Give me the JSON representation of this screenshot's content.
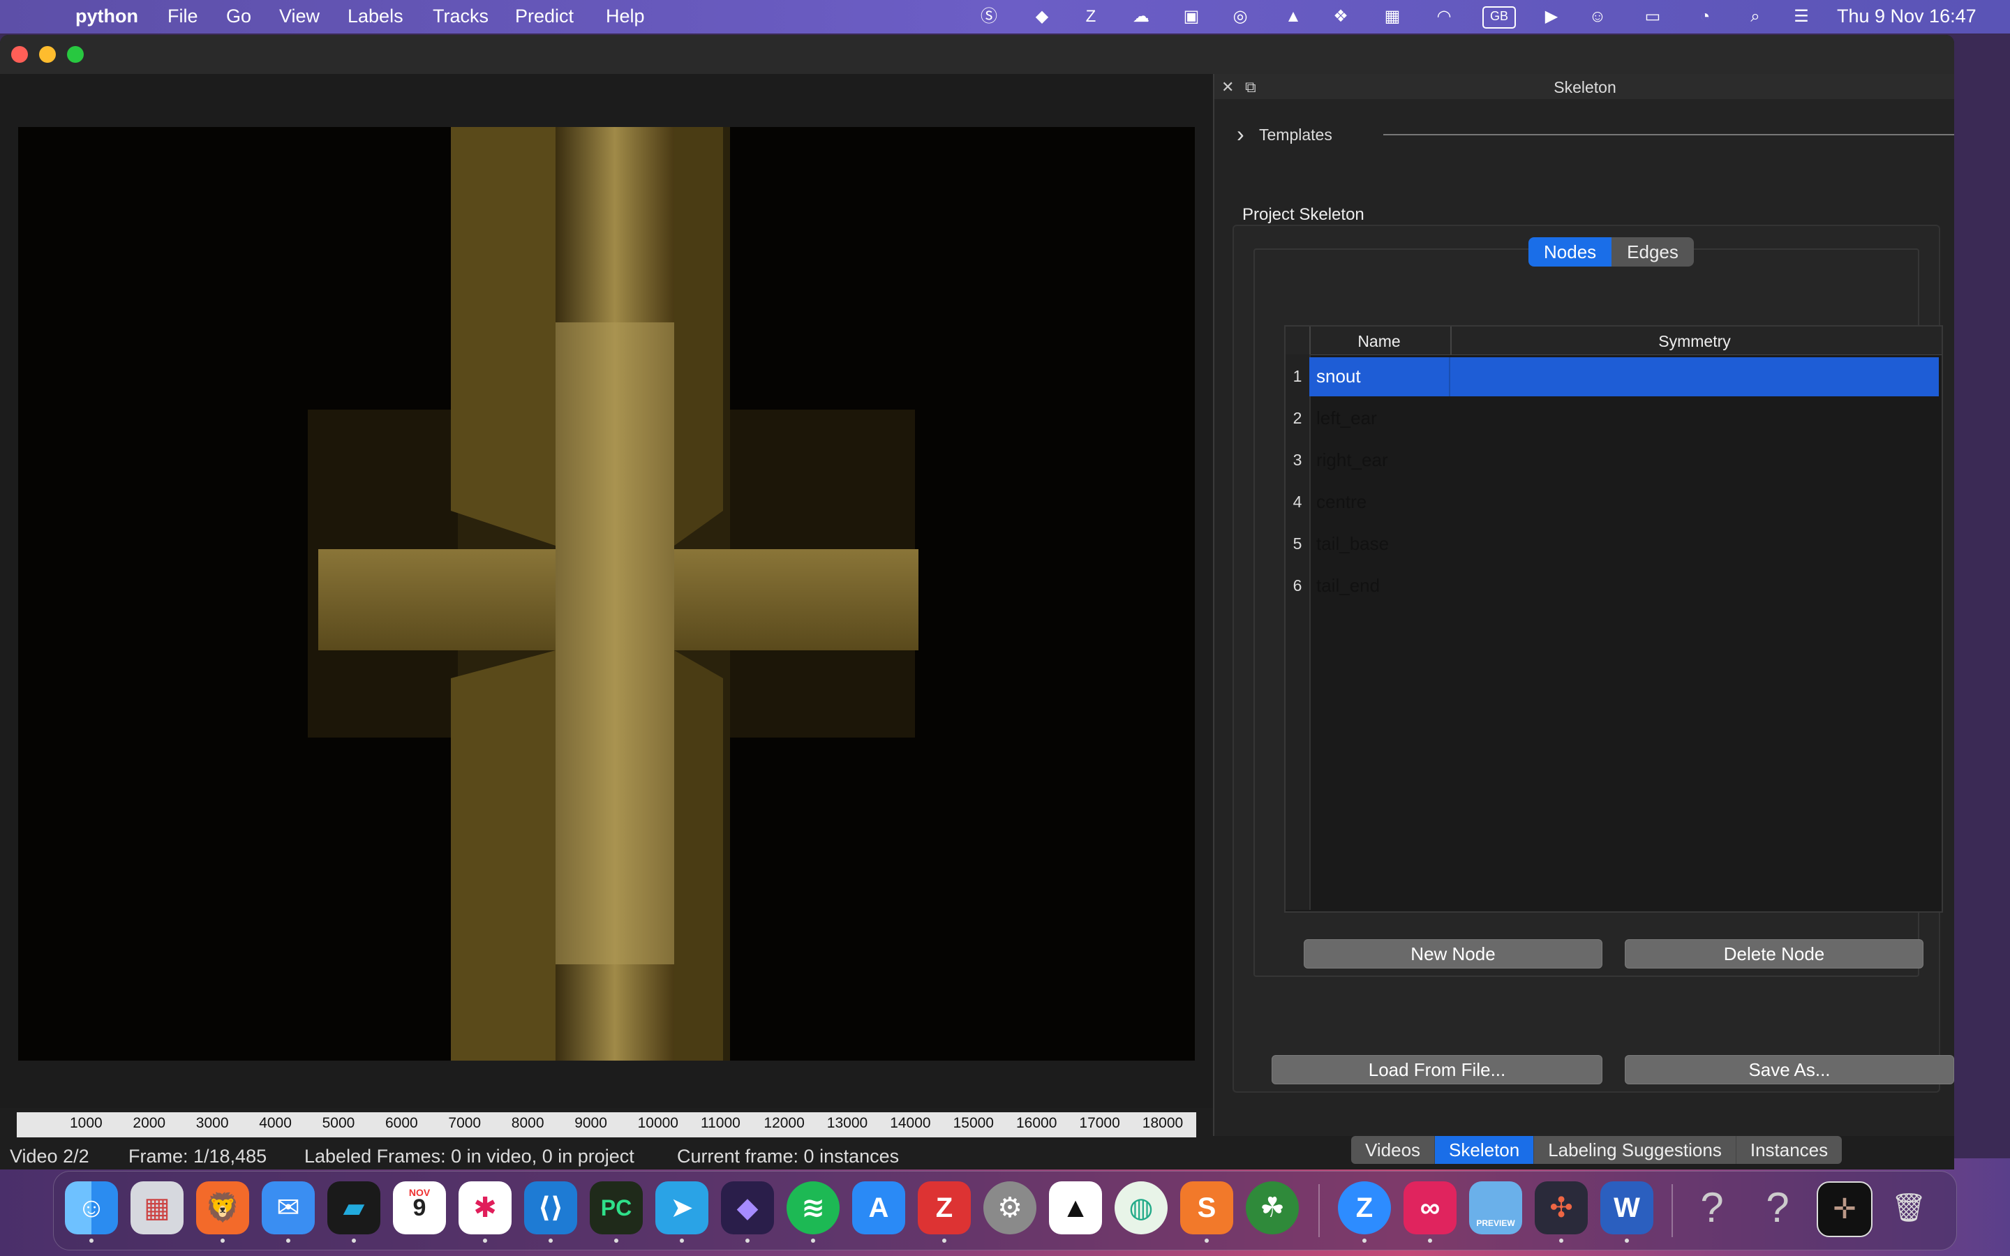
{
  "menubar": {
    "app_name": "python",
    "menus": [
      "File",
      "Go",
      "View",
      "Labels",
      "Tracks",
      "Predict",
      "Help"
    ],
    "clock": "Thu 9 Nov  16:47",
    "keyboard": "GB"
  },
  "panel": {
    "title": "Skeleton",
    "templates_label": "Templates",
    "project_skeleton_label": "Project Skeleton",
    "tabs": [
      "Nodes",
      "Edges"
    ],
    "table": {
      "columns": [
        "Name",
        "Symmetry"
      ],
      "rows": [
        {
          "num": "1",
          "name": "snout",
          "symmetry": ""
        },
        {
          "num": "2",
          "name": "left_ear",
          "symmetry": ""
        },
        {
          "num": "3",
          "name": "right_ear",
          "symmetry": ""
        },
        {
          "num": "4",
          "name": "centre",
          "symmetry": ""
        },
        {
          "num": "5",
          "name": "tail_base",
          "symmetry": ""
        },
        {
          "num": "6",
          "name": "tail_end",
          "symmetry": ""
        }
      ]
    },
    "new_node": "New Node",
    "delete_node": "Delete Node",
    "load_from_file": "Load From File...",
    "save_as": "Save As...",
    "bottom_tabs": [
      "Videos",
      "Skeleton",
      "Labeling Suggestions",
      "Instances"
    ]
  },
  "seekbar": {
    "ticks": [
      "1000",
      "2000",
      "3000",
      "4000",
      "5000",
      "6000",
      "7000",
      "8000",
      "9000",
      "10000",
      "11000",
      "12000",
      "13000",
      "14000",
      "15000",
      "16000",
      "17000",
      "18000"
    ]
  },
  "status": {
    "video": "Video 2/2",
    "frame": "Frame: 1/18,485",
    "labeled": "Labeled Frames: 0 in video, 0 in project",
    "current": "Current frame: 0 instances"
  },
  "dock": {
    "calendar_month": "NOV",
    "calendar_day": "9",
    "preview_label": "PREVIEW"
  }
}
